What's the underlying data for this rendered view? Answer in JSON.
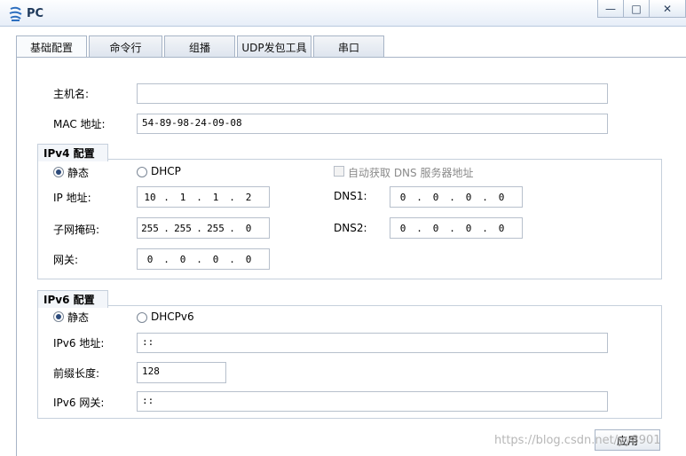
{
  "window": {
    "title": "PC",
    "app_icon": "network-pc-icon",
    "minimize": "—",
    "maximize": "□",
    "close": "✕"
  },
  "tabs": [
    {
      "label": "基础配置",
      "active": true
    },
    {
      "label": "命令行",
      "active": false
    },
    {
      "label": "组播",
      "active": false
    },
    {
      "label": "UDP发包工具",
      "active": false
    },
    {
      "label": "串口",
      "active": false
    }
  ],
  "basic": {
    "hostname_label": "主机名:",
    "hostname_value": "",
    "mac_label": "MAC 地址:",
    "mac_value": "54-89-98-24-09-08"
  },
  "ipv4": {
    "section_title": "IPv4 配置",
    "static_label": "静态",
    "static_selected": true,
    "dhcp_label": "DHCP",
    "auto_dns_label": "自动获取 DNS 服务器地址",
    "ip_label": "IP 地址:",
    "ip": [
      "10",
      "1",
      "1",
      "2"
    ],
    "mask_label": "子网掩码:",
    "mask": [
      "255",
      "255",
      "255",
      "0"
    ],
    "gateway_label": "网关:",
    "gateway": [
      "0",
      "0",
      "0",
      "0"
    ],
    "dns1_label": "DNS1:",
    "dns1": [
      "0",
      "0",
      "0",
      "0"
    ],
    "dns2_label": "DNS2:",
    "dns2": [
      "0",
      "0",
      "0",
      "0"
    ]
  },
  "ipv6": {
    "section_title": "IPv6 配置",
    "static_label": "静态",
    "static_selected": true,
    "dhcp_label": "DHCPv6",
    "ip_label": "IPv6 地址:",
    "ip_value": "::",
    "prefix_label": "前缀长度:",
    "prefix_value": "128",
    "gateway_label": "IPv6 网关:",
    "gateway_value": "::"
  },
  "apply_label": "应用",
  "watermark": "https://blog.csdn.net/yy8901"
}
